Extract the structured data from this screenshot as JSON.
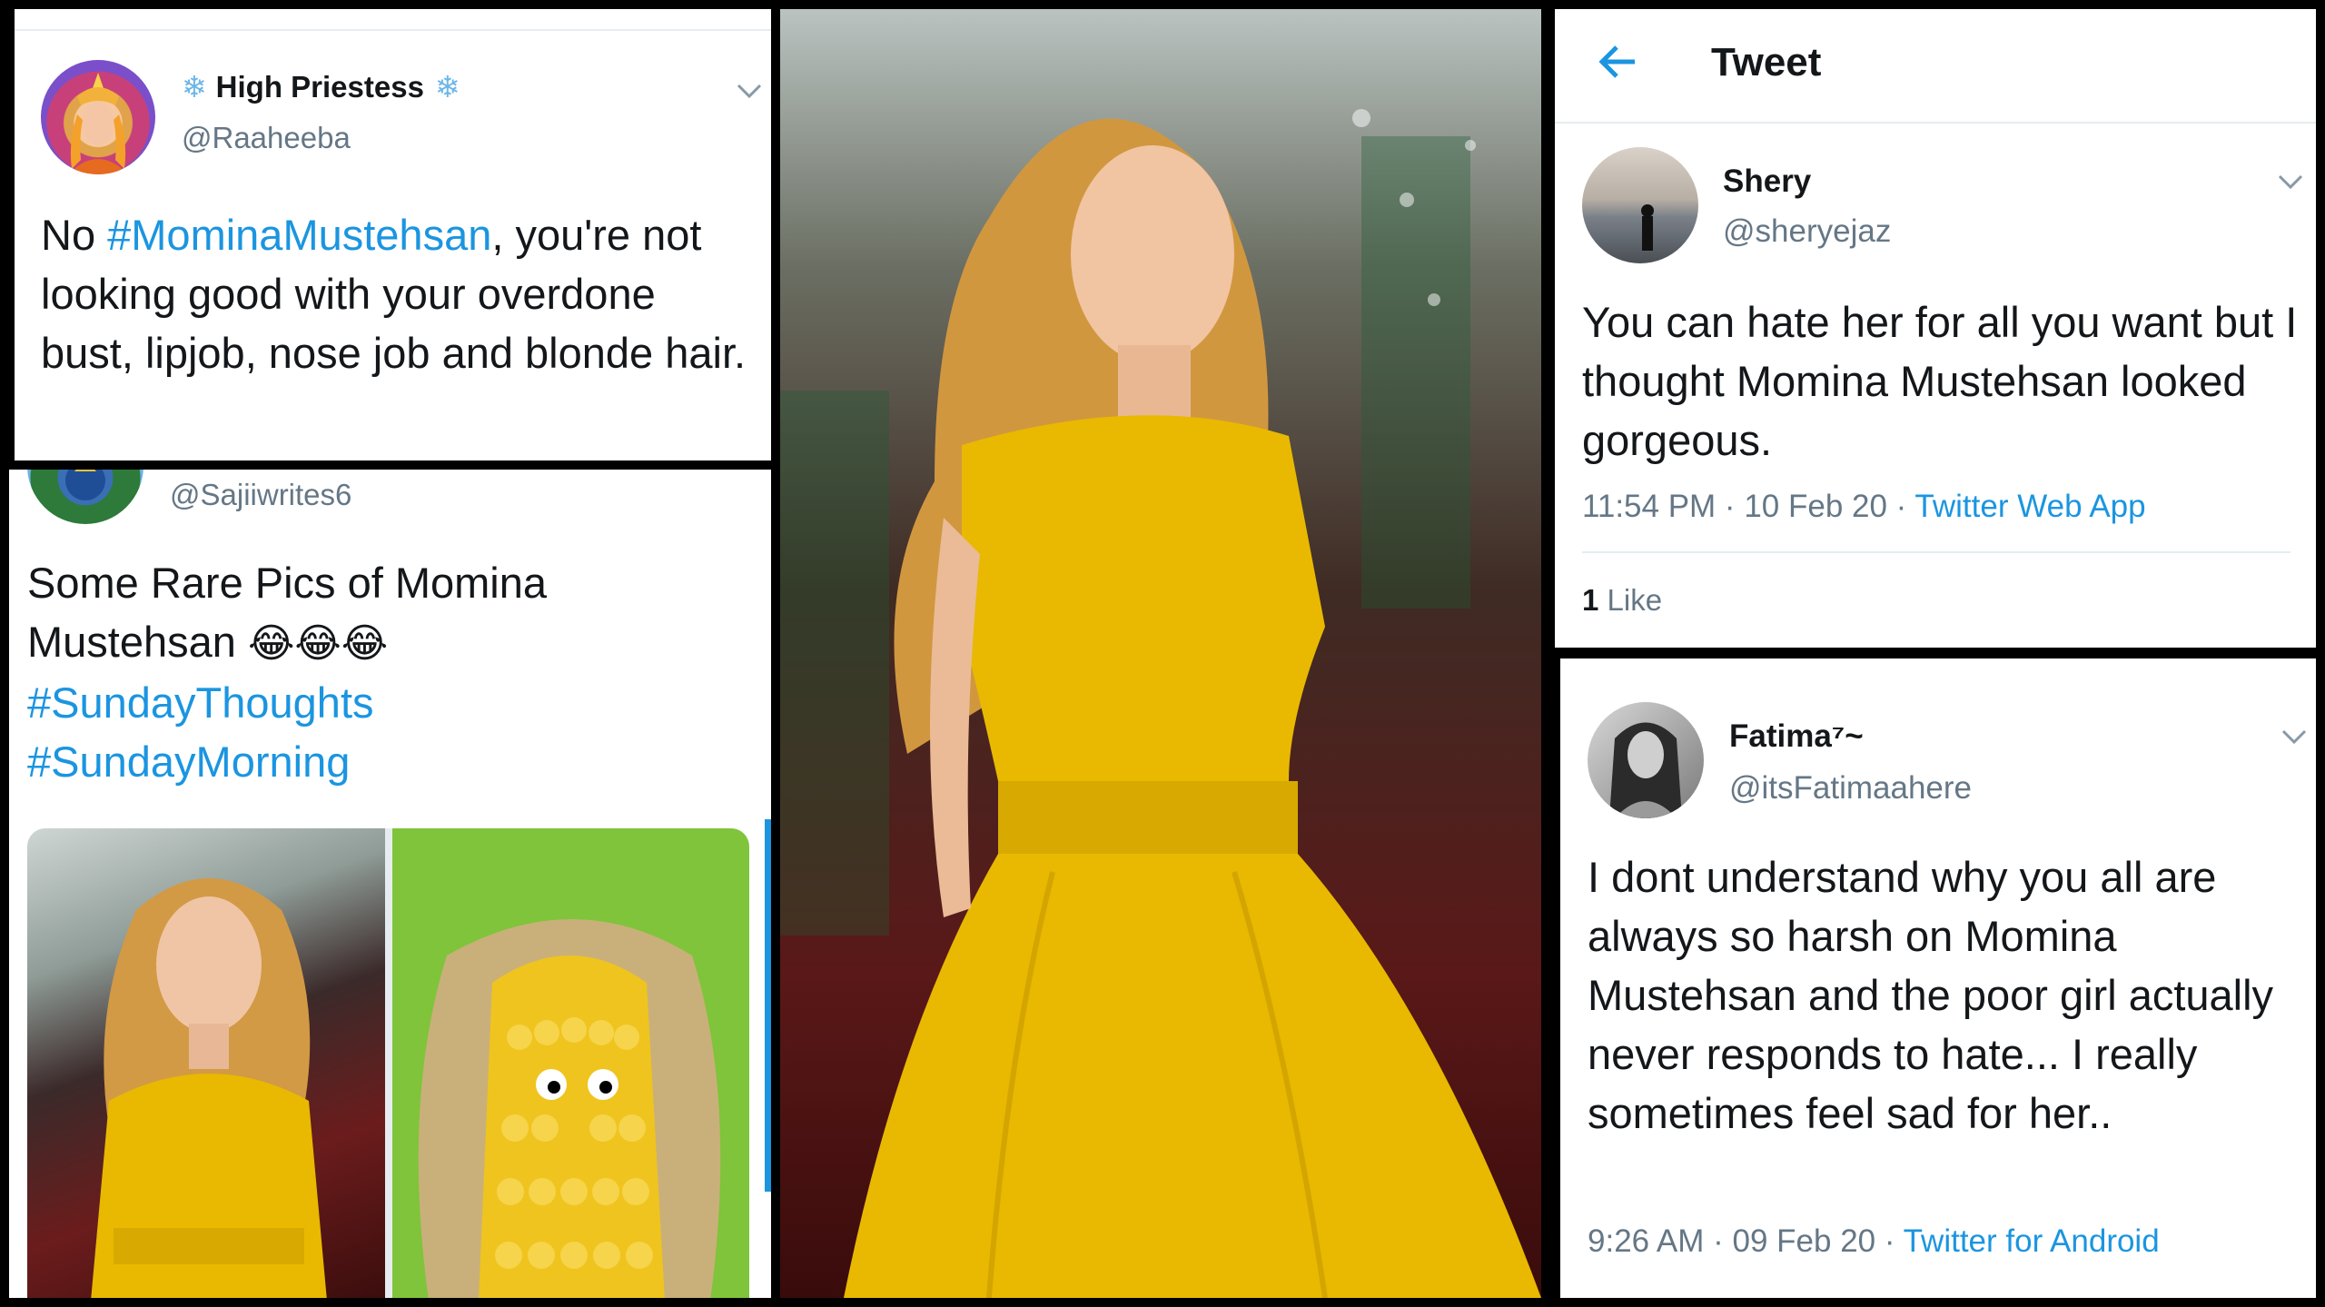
{
  "tweet1": {
    "display_name": "High Priestess",
    "snowflake_glyph": "❄",
    "handle": "@Raaheeba",
    "text_1": "No ",
    "hashtag": "#MominaMustehsan",
    "text_2": ", you're not looking good with your overdone bust, lipjob, nose job and blonde hair."
  },
  "tweet2": {
    "handle": "@Sajiiwrites6",
    "text": "Some Rare Pics of Momina Mustehsan ",
    "emoji": "😂😂😂",
    "hashtag_1": "#SundayThoughts",
    "hashtag_2": "#SundayMorning"
  },
  "tweet3": {
    "header_title": "Tweet",
    "display_name": "Shery",
    "handle": "@sheryejaz",
    "text": "You can hate her for all you want but I thought Momina Mustehsan looked gorgeous.",
    "time": "11:54 PM · 10 Feb 20 · ",
    "source": "Twitter Web App",
    "likes_count": "1",
    "likes_label": "Like"
  },
  "tweet4": {
    "display_name": "Fatima⁷~",
    "handle": "@itsFatimaahere",
    "text": "I dont understand why you all are always so harsh on Momina Mustehsan and the poor girl actually never responds to hate... I really sometimes feel sad for her..",
    "time": "9:26 AM · 09 Feb 20 · ",
    "source": "Twitter for Android"
  },
  "colors": {
    "link_blue": "#1b95e0",
    "dress_yellow": "#e8b900",
    "corn_green": "#7fc43a"
  },
  "icons": [
    "back-arrow-icon",
    "chevron-down-icon",
    "snowflake-icon"
  ]
}
